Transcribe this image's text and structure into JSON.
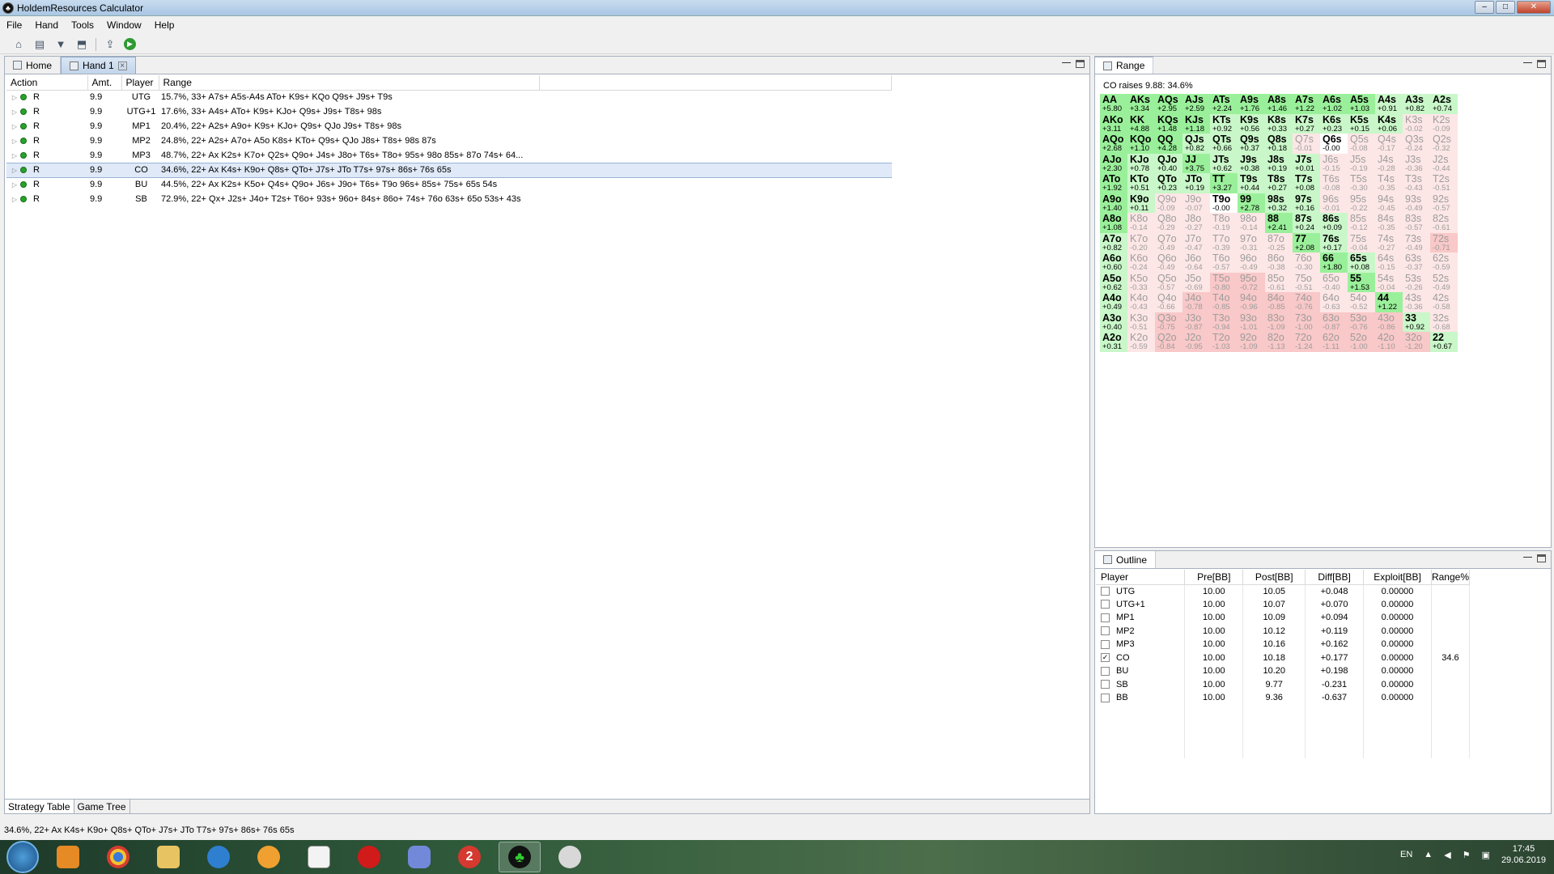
{
  "window": {
    "title": "HoldemResources Calculator",
    "min": "–",
    "max": "□",
    "close": "✕"
  },
  "menu": [
    "File",
    "Hand",
    "Tools",
    "Window",
    "Help"
  ],
  "left_panel": {
    "tabs": [
      {
        "label": "Home"
      },
      {
        "label": "Hand 1"
      }
    ],
    "columns": [
      "Action",
      "Amt.",
      "Player",
      "Range"
    ],
    "rows": [
      {
        "action": "R",
        "amt": "9.9",
        "player": "UTG",
        "range": "15.7%, 33+ A7s+ A5s-A4s ATo+ K9s+ KQo Q9s+ J9s+ T9s"
      },
      {
        "action": "R",
        "amt": "9.9",
        "player": "UTG+1",
        "range": "17.6%, 33+ A4s+ ATo+ K9s+ KJo+ Q9s+ J9s+ T8s+ 98s"
      },
      {
        "action": "R",
        "amt": "9.9",
        "player": "MP1",
        "range": "20.4%, 22+ A2s+ A9o+ K9s+ KJo+ Q9s+ QJo J9s+ T8s+ 98s"
      },
      {
        "action": "R",
        "amt": "9.9",
        "player": "MP2",
        "range": "24.8%, 22+ A2s+ A7o+ A5o K8s+ KTo+ Q9s+ QJo J8s+ T8s+ 98s 87s"
      },
      {
        "action": "R",
        "amt": "9.9",
        "player": "MP3",
        "range": "48.7%, 22+ Ax K2s+ K7o+ Q2s+ Q9o+ J4s+ J8o+ T6s+ T8o+ 95s+ 98o 85s+ 87o 74s+ 64..."
      },
      {
        "action": "R",
        "amt": "9.9",
        "player": "CO",
        "range": "34.6%, 22+ Ax K4s+ K9o+ Q8s+ QTo+ J7s+ JTo T7s+ 97s+ 86s+ 76s 65s",
        "selected": true
      },
      {
        "action": "R",
        "amt": "9.9",
        "player": "BU",
        "range": "44.5%, 22+ Ax K2s+ K5o+ Q4s+ Q9o+ J6s+ J9o+ T6s+ T9o 96s+ 85s+ 75s+ 65s 54s"
      },
      {
        "action": "R",
        "amt": "9.9",
        "player": "SB",
        "range": "72.9%, 22+ Qx+ J2s+ J4o+ T2s+ T6o+ 93s+ 96o+ 84s+ 86o+ 74s+ 76o 63s+ 65o 53s+ 43s"
      }
    ],
    "bottom_tabs": [
      "Strategy Table",
      "Game Tree"
    ]
  },
  "range_panel": {
    "title": "Range",
    "header": "CO raises 9.88: 34.6%",
    "hands": [
      [
        "AA",
        "+5.80"
      ],
      [
        "AKs",
        "+3.34"
      ],
      [
        "AQs",
        "+2.95"
      ],
      [
        "AJs",
        "+2.59"
      ],
      [
        "ATs",
        "+2.24"
      ],
      [
        "A9s",
        "+1.76"
      ],
      [
        "A8s",
        "+1.46"
      ],
      [
        "A7s",
        "+1.22"
      ],
      [
        "A6s",
        "+1.02"
      ],
      [
        "A5s",
        "+1.03"
      ],
      [
        "A4s",
        "+0.91"
      ],
      [
        "A3s",
        "+0.82"
      ],
      [
        "A2s",
        "+0.74"
      ],
      [
        "AKo",
        "+3.11"
      ],
      [
        "KK",
        "+4.88"
      ],
      [
        "KQs",
        "+1.48"
      ],
      [
        "KJs",
        "+1.18"
      ],
      [
        "KTs",
        "+0.92"
      ],
      [
        "K9s",
        "+0.56"
      ],
      [
        "K8s",
        "+0.33"
      ],
      [
        "K7s",
        "+0.27"
      ],
      [
        "K6s",
        "+0.23"
      ],
      [
        "K5s",
        "+0.15"
      ],
      [
        "K4s",
        "+0.06"
      ],
      [
        "K3s",
        "-0.02"
      ],
      [
        "K2s",
        "-0.09"
      ],
      [
        "AQo",
        "+2.68"
      ],
      [
        "KQo",
        "+1.10"
      ],
      [
        "QQ",
        "+4.28"
      ],
      [
        "QJs",
        "+0.82"
      ],
      [
        "QTs",
        "+0.66"
      ],
      [
        "Q9s",
        "+0.37"
      ],
      [
        "Q8s",
        "+0.18"
      ],
      [
        "Q7s",
        "-0.01"
      ],
      [
        "Q6s",
        "-0.00"
      ],
      [
        "Q5s",
        "-0.08"
      ],
      [
        "Q4s",
        "-0.17"
      ],
      [
        "Q3s",
        "-0.24"
      ],
      [
        "Q2s",
        "-0.32"
      ],
      [
        "AJo",
        "+2.30"
      ],
      [
        "KJo",
        "+0.78"
      ],
      [
        "QJo",
        "+0.40"
      ],
      [
        "JJ",
        "+3.75"
      ],
      [
        "JTs",
        "+0.62"
      ],
      [
        "J9s",
        "+0.38"
      ],
      [
        "J8s",
        "+0.19"
      ],
      [
        "J7s",
        "+0.01"
      ],
      [
        "J6s",
        "-0.15"
      ],
      [
        "J5s",
        "-0.19"
      ],
      [
        "J4s",
        "-0.28"
      ],
      [
        "J3s",
        "-0.36"
      ],
      [
        "J2s",
        "-0.44"
      ],
      [
        "ATo",
        "+1.92"
      ],
      [
        "KTo",
        "+0.51"
      ],
      [
        "QTo",
        "+0.23"
      ],
      [
        "JTo",
        "+0.19"
      ],
      [
        "TT",
        "+3.27"
      ],
      [
        "T9s",
        "+0.44"
      ],
      [
        "T8s",
        "+0.27"
      ],
      [
        "T7s",
        "+0.08"
      ],
      [
        "T6s",
        "-0.08"
      ],
      [
        "T5s",
        "-0.30"
      ],
      [
        "T4s",
        "-0.35"
      ],
      [
        "T3s",
        "-0.43"
      ],
      [
        "T2s",
        "-0.51"
      ],
      [
        "A9o",
        "+1.40"
      ],
      [
        "K9o",
        "+0.11"
      ],
      [
        "Q9o",
        "-0.09"
      ],
      [
        "J9o",
        "-0.07"
      ],
      [
        "T9o",
        "-0.00"
      ],
      [
        "99",
        "+2.78"
      ],
      [
        "98s",
        "+0.32"
      ],
      [
        "97s",
        "+0.16"
      ],
      [
        "96s",
        "-0.01"
      ],
      [
        "95s",
        "-0.22"
      ],
      [
        "94s",
        "-0.45"
      ],
      [
        "93s",
        "-0.49"
      ],
      [
        "92s",
        "-0.57"
      ],
      [
        "A8o",
        "+1.08"
      ],
      [
        "K8o",
        "-0.14"
      ],
      [
        "Q8o",
        "-0.29"
      ],
      [
        "J8o",
        "-0.27"
      ],
      [
        "T8o",
        "-0.19"
      ],
      [
        "98o",
        "-0.14"
      ],
      [
        "88",
        "+2.41"
      ],
      [
        "87s",
        "+0.24"
      ],
      [
        "86s",
        "+0.09"
      ],
      [
        "85s",
        "-0.12"
      ],
      [
        "84s",
        "-0.35"
      ],
      [
        "83s",
        "-0.57"
      ],
      [
        "82s",
        "-0.61"
      ],
      [
        "A7o",
        "+0.82"
      ],
      [
        "K7o",
        "-0.20"
      ],
      [
        "Q7o",
        "-0.49"
      ],
      [
        "J7o",
        "-0.47"
      ],
      [
        "T7o",
        "-0.39"
      ],
      [
        "97o",
        "-0.31"
      ],
      [
        "87o",
        "-0.25"
      ],
      [
        "77",
        "+2.08"
      ],
      [
        "76s",
        "+0.17"
      ],
      [
        "75s",
        "-0.04"
      ],
      [
        "74s",
        "-0.27"
      ],
      [
        "73s",
        "-0.49"
      ],
      [
        "72s",
        "-0.71"
      ],
      [
        "A6o",
        "+0.60"
      ],
      [
        "K6o",
        "-0.24"
      ],
      [
        "Q6o",
        "-0.49"
      ],
      [
        "J6o",
        "-0.64"
      ],
      [
        "T6o",
        "-0.57"
      ],
      [
        "96o",
        "-0.49"
      ],
      [
        "86o",
        "-0.38"
      ],
      [
        "76o",
        "-0.30"
      ],
      [
        "66",
        "+1.80"
      ],
      [
        "65s",
        "+0.08"
      ],
      [
        "64s",
        "-0.15"
      ],
      [
        "63s",
        "-0.37"
      ],
      [
        "62s",
        "-0.59"
      ],
      [
        "A5o",
        "+0.62"
      ],
      [
        "K5o",
        "-0.33"
      ],
      [
        "Q5o",
        "-0.57"
      ],
      [
        "J5o",
        "-0.69"
      ],
      [
        "T5o",
        "-0.80"
      ],
      [
        "95o",
        "-0.72"
      ],
      [
        "85o",
        "-0.61"
      ],
      [
        "75o",
        "-0.51"
      ],
      [
        "65o",
        "-0.40"
      ],
      [
        "55",
        "+1.53"
      ],
      [
        "54s",
        "-0.04"
      ],
      [
        "53s",
        "-0.26"
      ],
      [
        "52s",
        "-0.49"
      ],
      [
        "A4o",
        "+0.49"
      ],
      [
        "K4o",
        "-0.43"
      ],
      [
        "Q4o",
        "-0.66"
      ],
      [
        "J4o",
        "-0.78"
      ],
      [
        "T4o",
        "-0.85"
      ],
      [
        "94o",
        "-0.96"
      ],
      [
        "84o",
        "-0.85"
      ],
      [
        "74o",
        "-0.76"
      ],
      [
        "64o",
        "-0.63"
      ],
      [
        "54o",
        "-0.52"
      ],
      [
        "44",
        "+1.22"
      ],
      [
        "43s",
        "-0.36"
      ],
      [
        "42s",
        "-0.58"
      ],
      [
        "A3o",
        "+0.40"
      ],
      [
        "K3o",
        "-0.51"
      ],
      [
        "Q3o",
        "-0.75"
      ],
      [
        "J3o",
        "-0.87"
      ],
      [
        "T3o",
        "-0.94"
      ],
      [
        "93o",
        "-1.01"
      ],
      [
        "83o",
        "-1.09"
      ],
      [
        "73o",
        "-1.00"
      ],
      [
        "63o",
        "-0.87"
      ],
      [
        "53o",
        "-0.76"
      ],
      [
        "43o",
        "-0.86"
      ],
      [
        "33",
        "+0.92"
      ],
      [
        "32s",
        "-0.68"
      ],
      [
        "A2o",
        "+0.31"
      ],
      [
        "K2o",
        "-0.59"
      ],
      [
        "Q2o",
        "-0.84"
      ],
      [
        "J2o",
        "-0.95"
      ],
      [
        "T2o",
        "-1.03"
      ],
      [
        "92o",
        "-1.09"
      ],
      [
        "82o",
        "-1.13"
      ],
      [
        "72o",
        "-1.24"
      ],
      [
        "62o",
        "-1.11"
      ],
      [
        "52o",
        "-1.00"
      ],
      [
        "42o",
        "-1.10"
      ],
      [
        "32o",
        "-1.20"
      ],
      [
        "22",
        "+0.67"
      ]
    ]
  },
  "outline_panel": {
    "title": "Outline",
    "columns": [
      "Player",
      "Pre[BB]",
      "Post[BB]",
      "Diff[BB]",
      "Exploit[BB]",
      "Range%"
    ],
    "rows": [
      {
        "player": "UTG",
        "pre": "10.00",
        "post": "10.05",
        "diff": "+0.048",
        "exploit": "0.00000",
        "range": "",
        "checked": false
      },
      {
        "player": "UTG+1",
        "pre": "10.00",
        "post": "10.07",
        "diff": "+0.070",
        "exploit": "0.00000",
        "range": "",
        "checked": false
      },
      {
        "player": "MP1",
        "pre": "10.00",
        "post": "10.09",
        "diff": "+0.094",
        "exploit": "0.00000",
        "range": "",
        "checked": false
      },
      {
        "player": "MP2",
        "pre": "10.00",
        "post": "10.12",
        "diff": "+0.119",
        "exploit": "0.00000",
        "range": "",
        "checked": false
      },
      {
        "player": "MP3",
        "pre": "10.00",
        "post": "10.16",
        "diff": "+0.162",
        "exploit": "0.00000",
        "range": "",
        "checked": false
      },
      {
        "player": "CO",
        "pre": "10.00",
        "post": "10.18",
        "diff": "+0.177",
        "exploit": "0.00000",
        "range": "34.6",
        "checked": true
      },
      {
        "player": "BU",
        "pre": "10.00",
        "post": "10.20",
        "diff": "+0.198",
        "exploit": "0.00000",
        "range": "",
        "checked": false
      },
      {
        "player": "SB",
        "pre": "10.00",
        "post": "9.77",
        "diff": "-0.231",
        "exploit": "0.00000",
        "range": "",
        "checked": false
      },
      {
        "player": "BB",
        "pre": "10.00",
        "post": "9.36",
        "diff": "-0.637",
        "exploit": "0.00000",
        "range": "",
        "checked": false
      }
    ]
  },
  "status": {
    "text": "34.6%, 22+ Ax K4s+ K9o+ Q8s+ QTo+ J7s+ JTo T7s+ 97s+ 86s+ 76s 65s"
  },
  "taskbar": {
    "lang": "EN",
    "time": "17:45",
    "date": "29.06.2019",
    "badge": "2"
  }
}
